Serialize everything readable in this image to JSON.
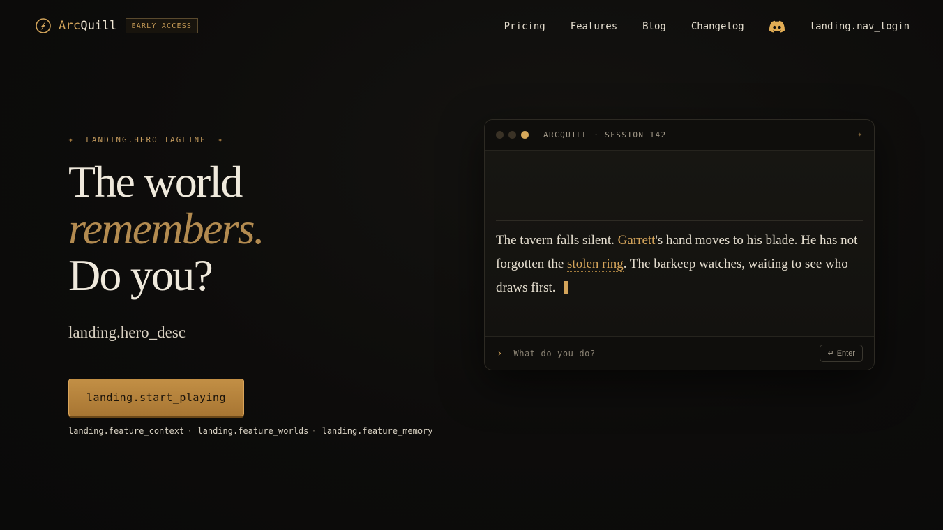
{
  "brand": {
    "name_prefix": "Arc",
    "name_suffix": "Quill",
    "badge": "EARLY ACCESS",
    "accent_color": "#d4a55b"
  },
  "nav": {
    "links": [
      "Pricing",
      "Features",
      "Blog",
      "Changelog"
    ],
    "discord_icon": "discord-icon",
    "login_label": "landing.nav_login"
  },
  "hero": {
    "tagline_star": "✦",
    "tagline": "LANDING.HERO_TAGLINE",
    "headline_line1": "The world",
    "headline_line2": "remembers.",
    "headline_line3": "Do you?",
    "description": "landing.hero_desc",
    "cta_label": "landing.start_playing",
    "features": [
      "landing.feature_context",
      "landing.feature_worlds",
      "landing.feature_memory"
    ],
    "feature_separator": "·"
  },
  "terminal": {
    "title": "ARCQUILL · SESSION_142",
    "star": "✦",
    "story": {
      "part1": "The tavern falls silent. ",
      "highlight1": "Garrett",
      "part2": "'s hand moves to his blade. He has not forgotten the ",
      "highlight2": "stolen ring",
      "part3": ". The barkeep watches, waiting to see who draws first."
    },
    "prompt_caret": "›",
    "input_placeholder": "What do you do?",
    "enter_icon": "↵",
    "enter_label": "Enter"
  }
}
